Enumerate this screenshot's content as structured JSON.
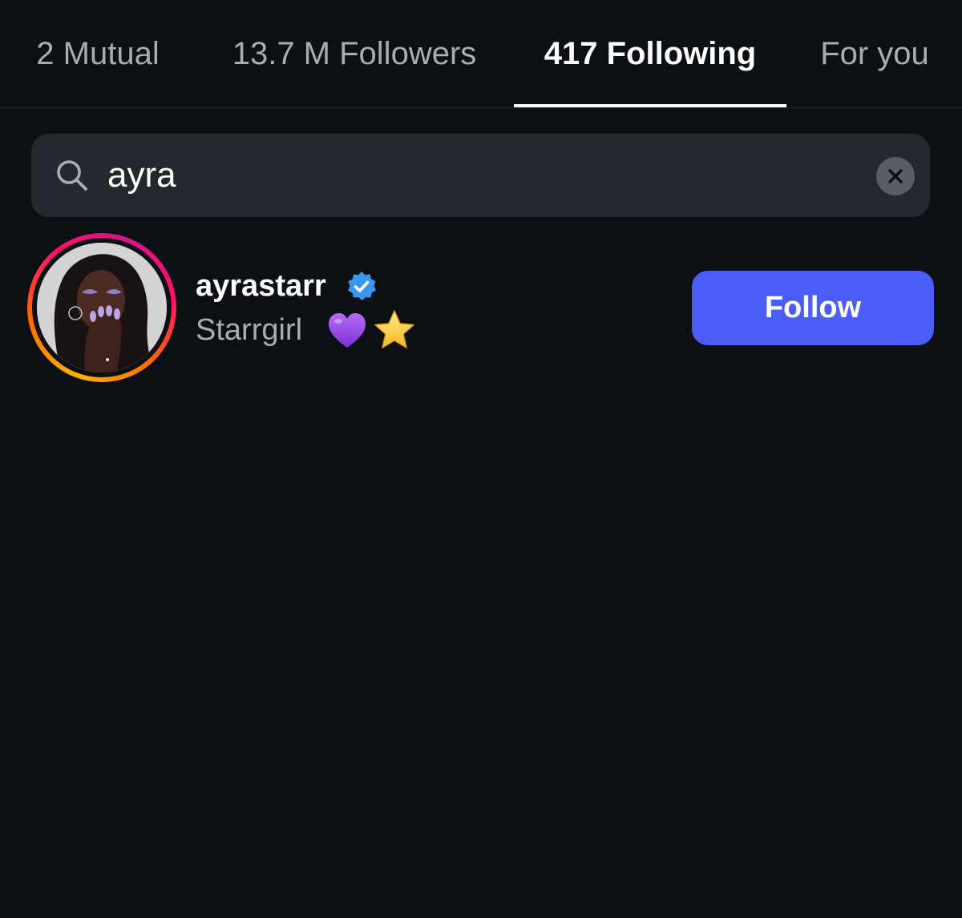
{
  "tabs": [
    {
      "label": "2 Mutual",
      "active": false
    },
    {
      "label": "13.7 M Followers",
      "active": false
    },
    {
      "label": "417 Following",
      "active": true
    },
    {
      "label": "For you",
      "active": false
    }
  ],
  "search": {
    "value": "ayra",
    "icon": "search-icon",
    "clear_icon": "clear-icon"
  },
  "results": [
    {
      "username": "ayrastarr",
      "verified": true,
      "bio": "Starrgirl",
      "bio_emoji": [
        "purple-heart",
        "star"
      ],
      "action_label": "Follow"
    }
  ],
  "colors": {
    "background": "#0c0f14",
    "search_field": "#25282e",
    "follow_button": "#4a5df9",
    "verified_badge": "#3897f0",
    "secondary_text": "#a8acb3",
    "active_tab_indicator": "#ffffff"
  }
}
